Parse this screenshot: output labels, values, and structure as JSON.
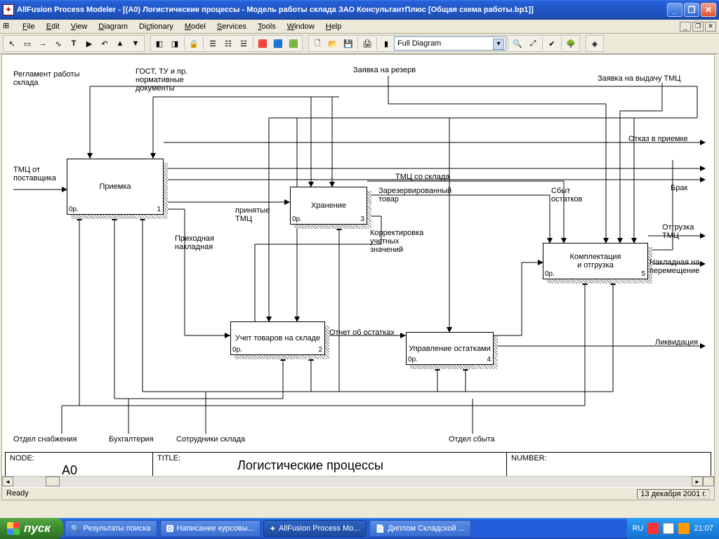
{
  "window": {
    "title": "AllFusion Process Modeler  - [(A0) Логистические процессы    - Модель работы склада ЗАО КонсультантПлюс  [Общая схема работы.bp1]]"
  },
  "menus": [
    "File",
    "Edit",
    "View",
    "Diagram",
    "Dictionary",
    "Model",
    "Services",
    "Tools",
    "Window",
    "Help"
  ],
  "toolbar": {
    "view_combo": "Full Diagram"
  },
  "diagram": {
    "node_label": "NODE:",
    "node_value": "A0",
    "title_label": "TITLE:",
    "title_value": "Логистические процессы",
    "number_label": "NUMBER:",
    "boxes": {
      "b1": {
        "name": "Приемка",
        "node": "0р.",
        "num": "1"
      },
      "b2": {
        "name": "Хранение",
        "node": "0р.",
        "num": "3"
      },
      "b3": {
        "name": "Учет товаров на складе",
        "node": "0р.",
        "num": "2"
      },
      "b4": {
        "name": "Управление остатками",
        "node": "0р.",
        "num": "4"
      },
      "b5": {
        "name": "Комплектация\nи отгрузка",
        "node": "0р.",
        "num": "5"
      }
    },
    "labels": {
      "l_reglament": "Регламент работы\nсклада",
      "l_gost": "ГОСТ, ТУ и пр.\nнормативные\nдокументы",
      "l_zayavka_rez": "Заявка на резерв",
      "l_zayavka_vyd": "Заявка на выдачу ТМЦ",
      "l_tmc_post": "ТМЦ от\nпоставщика",
      "l_otkaz": "Отказ в приемке",
      "l_brak": "Брак",
      "l_prinyat": "принятые\nТМЦ",
      "l_tmc_skl": "ТМЦ со склада",
      "l_zarez": "Зарезервированный\nтовар",
      "l_sbyt": "Сбыт\nостатков",
      "l_otgr_tmc": "Отгрузка\nТМЦ",
      "l_nakl_per": "Накладная на\nперемещение",
      "l_likv": "Ликвидация",
      "l_prihod": "Приходная\nнакладная",
      "l_korrekt": "Корректировка\nучетных\nзначений",
      "l_otchet": "Отчет об остатках",
      "l_otd_snab": "Отдел снабжения",
      "l_buh": "Бухгалтерия",
      "l_sotr": "Сотрудники склада",
      "l_otd_sbyt": "Отдел сбыта"
    }
  },
  "status": {
    "ready": "Ready",
    "date": "13 декабря 2001 г."
  },
  "taskbar": {
    "start": "пуск",
    "items": [
      "Результаты поиска",
      "Написание курсовы...",
      "AllFusion Process Mo...",
      "Диплом Складской ..."
    ],
    "lang": "RU",
    "clock": "21:07"
  }
}
